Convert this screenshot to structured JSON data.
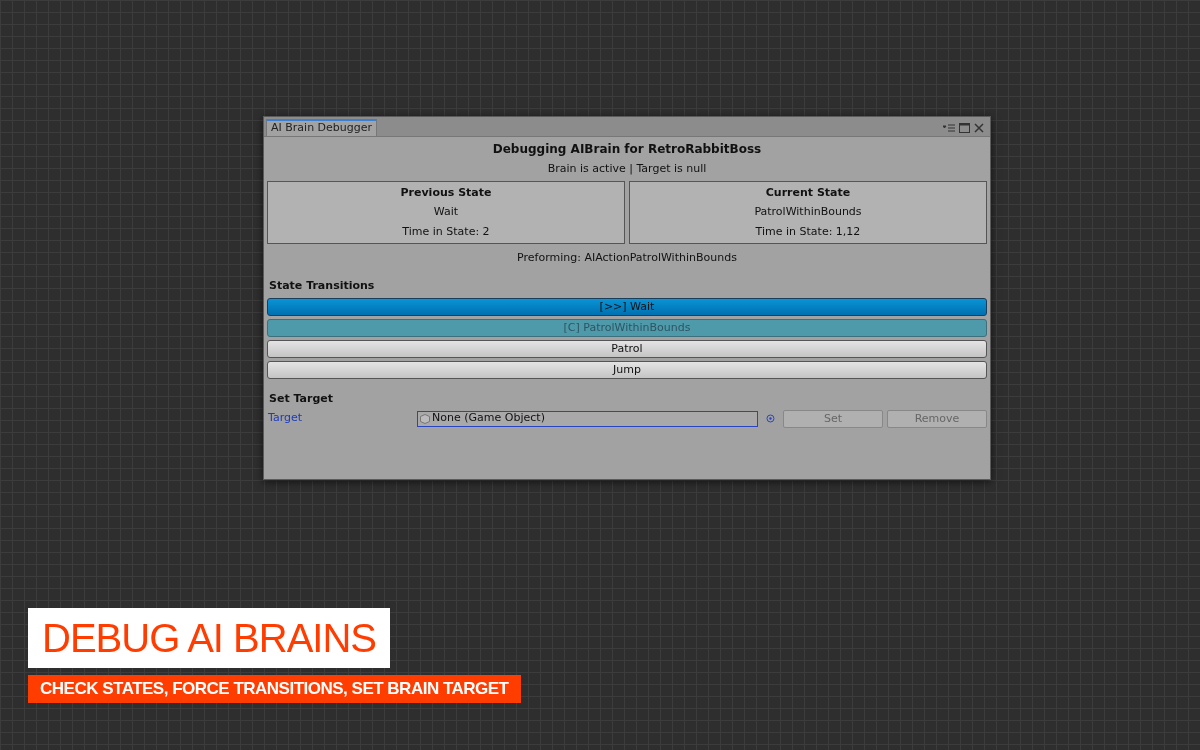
{
  "window": {
    "title": "AI Brain Debugger"
  },
  "header": {
    "title": "Debugging AIBrain for RetroRabbitBoss",
    "status": "Brain is active | Target is null"
  },
  "states": [
    {
      "heading": "Previous State",
      "name": "Wait",
      "time": "Time in State: 2"
    },
    {
      "heading": "Current State",
      "name": "PatrolWithinBounds",
      "time": "Time in State: 1,12"
    }
  ],
  "performing": "Preforming: AIActionPatrolWithinBounds",
  "transitions": {
    "heading": "State Transitions",
    "items": [
      {
        "label": "[>>] Wait",
        "kind": "next"
      },
      {
        "label": "[C] PatrolWithinBounds",
        "kind": "current"
      },
      {
        "label": "Patrol",
        "kind": "normal"
      },
      {
        "label": "Jump",
        "kind": "normal"
      }
    ]
  },
  "set_target": {
    "heading": "Set Target",
    "label": "Target",
    "value": "None (Game Object)",
    "buttons": [
      {
        "label": "Set",
        "disabled": true
      },
      {
        "label": "Remove",
        "disabled": true
      }
    ]
  },
  "banner": {
    "title": "DEBUG AI BRAINS",
    "subtitle": "CHECK STATES, FORCE TRANSITIONS, SET BRAIN TARGET"
  }
}
